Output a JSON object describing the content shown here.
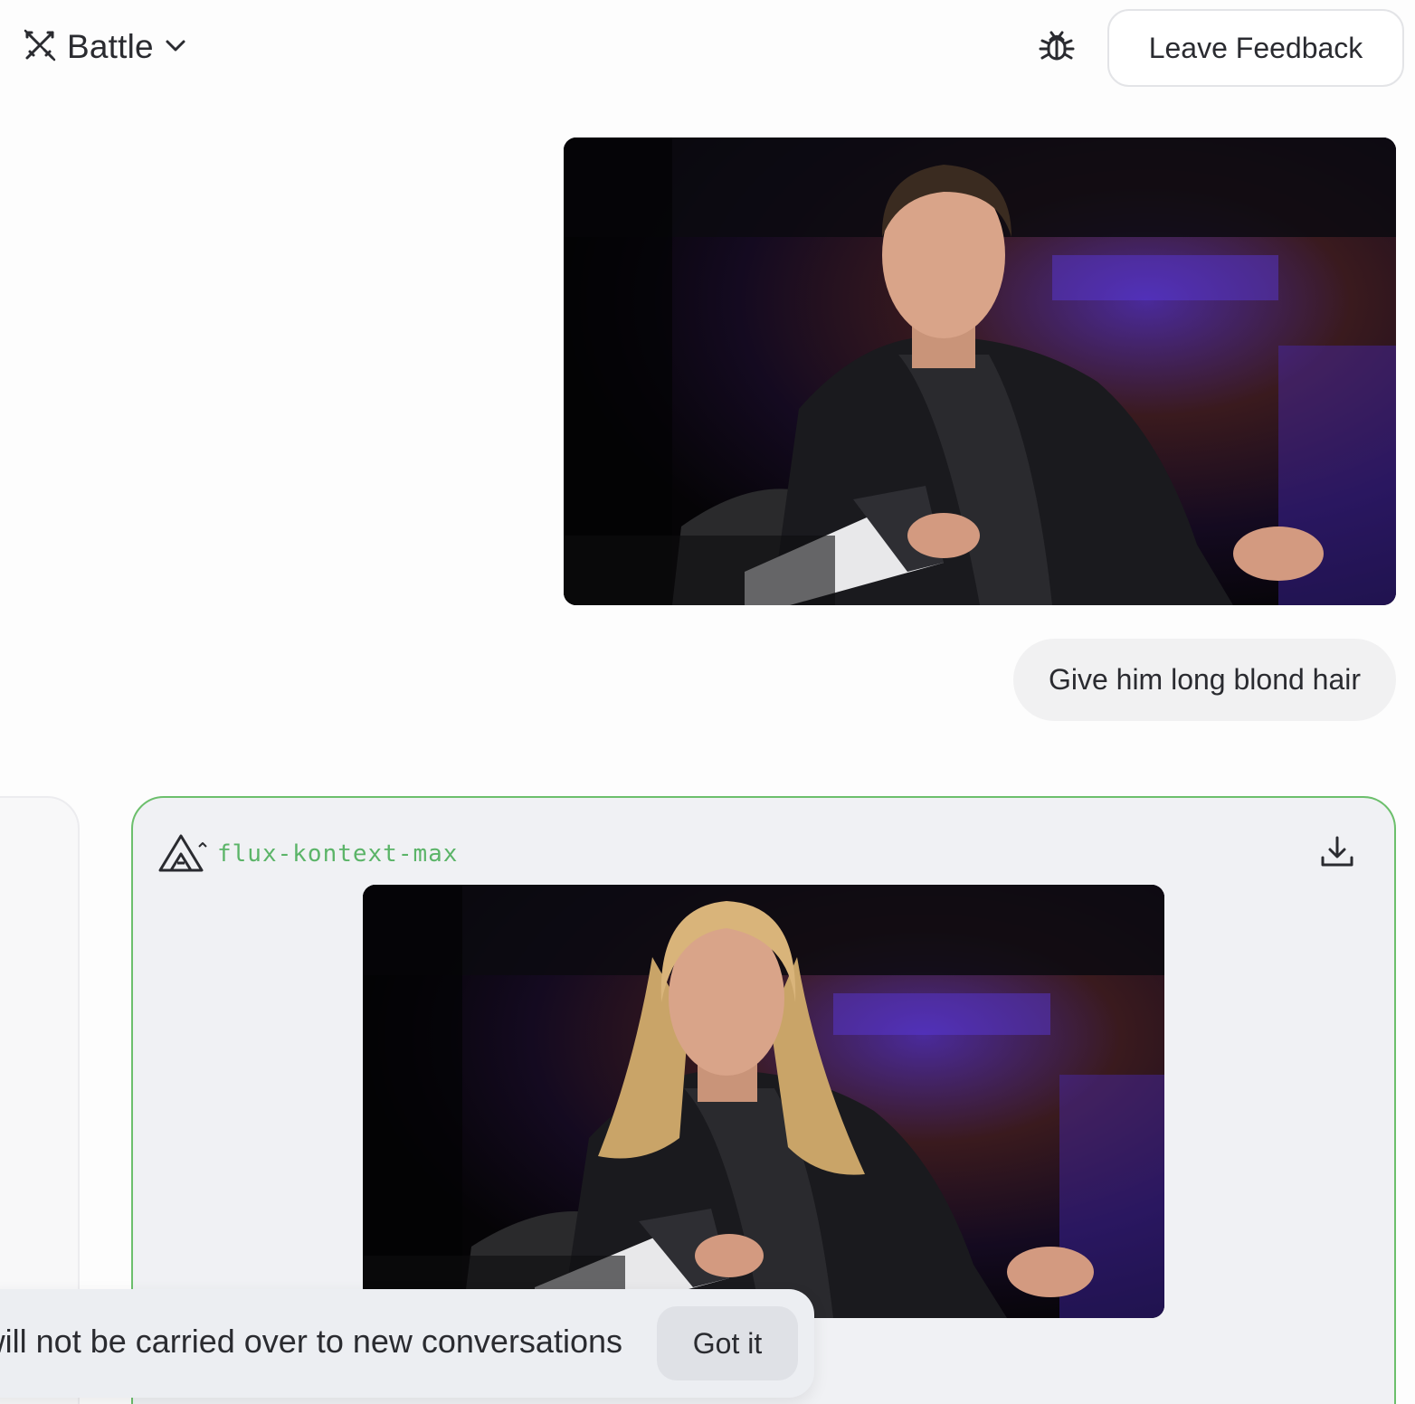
{
  "header": {
    "mode_icon": "crossed-swords-icon",
    "mode_label": "Battle",
    "mode_dropdown_icon": "chevron-down-icon",
    "bug_icon": "bug-icon",
    "feedback_label": "Leave Feedback"
  },
  "conversation": {
    "user_image": {
      "description": "uploaded photo",
      "subject_hair_color": "#3a2b20"
    },
    "user_message": "Give him long blond hair"
  },
  "response": {
    "model_icon": "triangle-logo-icon",
    "model_name": "flux-kontext-max",
    "download_icon": "download-icon",
    "result_image": {
      "description": "edited photo",
      "subject_hair_color": "#d9b47a"
    },
    "accent_color": "#5bb468"
  },
  "toast": {
    "message": "Images will not be carried over to new conversations",
    "button_label": "Got it"
  }
}
